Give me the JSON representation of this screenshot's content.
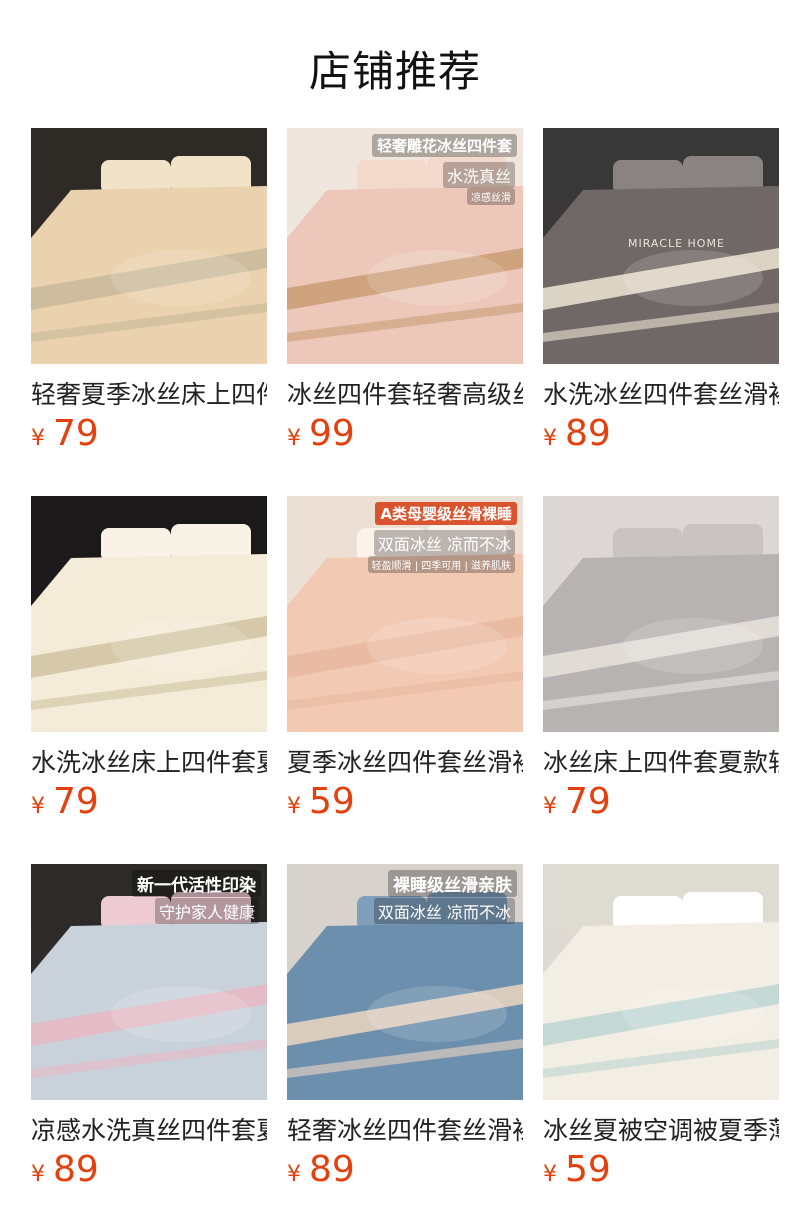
{
  "page": {
    "title": "店铺推荐"
  },
  "currency_symbol": "¥",
  "products": [
    {
      "name": "轻奢夏季冰丝床上四件套",
      "price": "79",
      "image_text": [],
      "palette": {
        "bg": "#2f2a27",
        "bed": "#e9d2ad",
        "accent": "#c8b89a",
        "pillow": "#f1e3c8"
      }
    },
    {
      "name": "冰丝四件套轻奢高级丝滑",
      "price": "99",
      "image_text": [
        "轻奢雕花冰丝四件套",
        "水洗真丝",
        "凉感丝滑"
      ],
      "palette": {
        "bg": "#efe6dd",
        "bed": "#edc8ba",
        "accent": "#c89c73",
        "pillow": "#f3d8cc"
      }
    },
    {
      "name": "水洗冰丝四件套丝滑裸睡",
      "price": "89",
      "image_text": [
        "MIRACLE HOME"
      ],
      "palette": {
        "bg": "#3a3838",
        "bed": "#6f6866",
        "accent": "#efe6d4",
        "pillow": "#898381"
      }
    },
    {
      "name": "水洗冰丝床上四件套夏季",
      "price": "79",
      "image_text": [],
      "palette": {
        "bg": "#1c1a1a",
        "bed": "#f4ecd9",
        "accent": "#cfc3a0",
        "pillow": "#f8f3e6"
      }
    },
    {
      "name": "夏季冰丝四件套丝滑裸睡",
      "price": "59",
      "image_text": [
        "A类母婴级丝滑裸睡",
        "双面冰丝 凉而不冰",
        "轻盈顺滑 | 四季可用 | 滋养肌肤"
      ],
      "palette": {
        "bg": "#ecdfd3",
        "bed": "#f2c9b3",
        "accent": "#e7b9a0",
        "pillow": "#fbf2ea"
      }
    },
    {
      "name": "冰丝床上四件套夏款轻奢",
      "price": "79",
      "image_text": [],
      "palette": {
        "bg": "#dcd7d4",
        "bed": "#b7b3b3",
        "accent": "#e8e2da",
        "pillow": "#c9c3c2"
      }
    },
    {
      "name": "凉感水洗真丝四件套夏季",
      "price": "89",
      "image_text": [
        "新一代活性印染",
        "守护家人健康"
      ],
      "palette": {
        "bg": "#2e2b2a",
        "bed": "#c9d2da",
        "accent": "#e7b8c3",
        "pillow": "#eecad2"
      }
    },
    {
      "name": "轻奢冰丝四件套丝滑裸睡",
      "price": "89",
      "image_text": [
        "裸睡级丝滑亲肤",
        "双面冰丝 凉而不冰"
      ],
      "palette": {
        "bg": "#d8d2cd",
        "bed": "#6d8fae",
        "accent": "#ecd7bf",
        "pillow": "#7f9fbd"
      }
    },
    {
      "name": "冰丝夏被空调被夏季薄款",
      "price": "59",
      "image_text": [],
      "palette": {
        "bg": "#dedad3",
        "bed": "#f2eee3",
        "accent": "#bcd5d2",
        "pillow": "#ffffff"
      }
    }
  ]
}
